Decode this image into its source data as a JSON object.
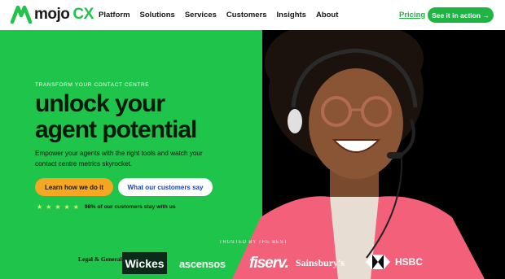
{
  "nav": {
    "logo_word": "mojo",
    "logo_suffix": "CX",
    "links": [
      "Platform",
      "Solutions",
      "Services",
      "Customers",
      "Insights",
      "About"
    ],
    "pricing": "Pricing",
    "cta": "See it in action →"
  },
  "hero": {
    "eyebrow": "TRANSFORM YOUR CONTACT CENTRE",
    "headline": "unlock your agent potential",
    "subtext": "Empower your agents with the right tools and watch your contact centre metrics skyrocket.",
    "primary_button": "Learn how we do it",
    "secondary_button": "What our customers say",
    "rating_stars": 5,
    "rating_text": "98% of our customers stay with us"
  },
  "trusted": {
    "label": "TRUSTED BY THE BEST",
    "brands": {
      "legal_general": "Legal & General",
      "wickes": "Wickes",
      "ascensos": "ascensos",
      "fiserv": "fiserv.",
      "sainsburys": "Sainsbury's",
      "hsbc": "HSBC"
    }
  },
  "colors": {
    "brand_green": "#1fc44a",
    "button_orange": "#f5a623",
    "link_blue": "#1a45c8"
  }
}
